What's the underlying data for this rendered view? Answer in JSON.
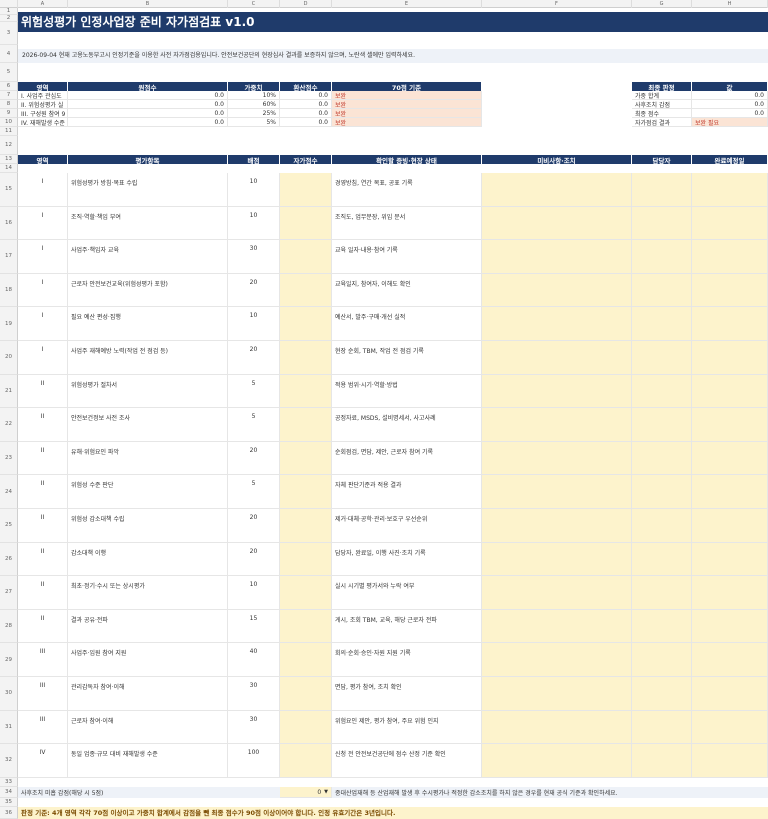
{
  "columns": [
    "A",
    "B",
    "C",
    "D",
    "E",
    "F",
    "G",
    "H"
  ],
  "title": "위험성평가 인정사업장 준비 자가점검표 v1.0",
  "note": "2026-09-04 현재 고용노동부고시 인정기준을 이용한 사전 자가점검용입니다. 안전보건공단의 현장심사 결과를 보증하지 않으며, 노란색 셀에만 입력하세요.",
  "summary": {
    "headers": [
      "영역",
      "원점수",
      "가중치",
      "환산점수",
      "70점 기준"
    ],
    "rows": [
      {
        "area": "I. 사업주 관심도",
        "raw": "0.0",
        "weight": "10%",
        "conv": "0.0",
        "std": "보완"
      },
      {
        "area": "II. 위험성평가 실",
        "raw": "0.0",
        "weight": "60%",
        "conv": "0.0",
        "std": "보완"
      },
      {
        "area": "III. 구성원 참여 9",
        "raw": "0.0",
        "weight": "25%",
        "conv": "0.0",
        "std": "보완"
      },
      {
        "area": "IV. 재해발생 수준",
        "raw": "0.0",
        "weight": "5%",
        "conv": "0.0",
        "std": "보완"
      }
    ]
  },
  "verdict": {
    "headers": [
      "최종 판정",
      "값"
    ],
    "rows": [
      {
        "label": "가중 합계",
        "value": "0.0"
      },
      {
        "label": "사후조치 감점",
        "value": "0.0"
      },
      {
        "label": "최종 점수",
        "value": "0.0"
      },
      {
        "label": "자가점검 결과",
        "value": "보완 필요"
      }
    ]
  },
  "table": {
    "headers": [
      "영역",
      "평가항목",
      "배점",
      "자가점수",
      "확인할 증빙·현장 상태",
      "미비사항·조치",
      "담당자",
      "완료예정일"
    ],
    "rows": [
      {
        "area": "I",
        "item": "위험성평가 방침·목표 수립",
        "score": "10",
        "evidence": "경영방침, 연간 목표, 공표 기록"
      },
      {
        "area": "I",
        "item": "조직·역할·책임 부여",
        "score": "10",
        "evidence": "조직도, 업무분장, 위임 문서"
      },
      {
        "area": "I",
        "item": "사업주·책임자 교육",
        "score": "30",
        "evidence": "교육 일자·내용·참여 기록"
      },
      {
        "area": "I",
        "item": "근로자 안전보건교육(위험성평가 포함)",
        "score": "20",
        "evidence": "교육일지, 참여자, 이해도 확인"
      },
      {
        "area": "I",
        "item": "필요 예산 편성·집행",
        "score": "10",
        "evidence": "예산서, 발주·구매·개선 실적"
      },
      {
        "area": "I",
        "item": "사업주 재해예방 노력(작업 전 점검 등)",
        "score": "20",
        "evidence": "현장 순회, TBM, 작업 전 점검 기록"
      },
      {
        "area": "II",
        "item": "위험성평가 절차서",
        "score": "5",
        "evidence": "적용 범위·시기·역할·방법"
      },
      {
        "area": "II",
        "item": "안전보건정보 사전 조사",
        "score": "5",
        "evidence": "공정자료, MSDS, 설비명세서, 사고사례"
      },
      {
        "area": "II",
        "item": "유해·위험요인 파악",
        "score": "20",
        "evidence": "순회점검, 면담, 제안, 근로자 참여 기록"
      },
      {
        "area": "II",
        "item": "위험성 수준 판단",
        "score": "5",
        "evidence": "자체 판단기준과 적용 결과"
      },
      {
        "area": "II",
        "item": "위험성 감소대책 수립",
        "score": "20",
        "evidence": "제거·대체·공학·관리·보호구 우선순위"
      },
      {
        "area": "II",
        "item": "감소대책 이행",
        "score": "20",
        "evidence": "담당자, 완료일, 이행 사진·조치 기록"
      },
      {
        "area": "II",
        "item": "최초·정기·수시 또는 상시평가",
        "score": "10",
        "evidence": "실시 시기별 평가서와 누락 여부"
      },
      {
        "area": "II",
        "item": "결과 공유·전파",
        "score": "15",
        "evidence": "게시, 조회 TBM, 교육, 해당 근로자 전파"
      },
      {
        "area": "III",
        "item": "사업주·임원 참여 지원",
        "score": "40",
        "evidence": "회의·순회·승인·자원 지원 기록"
      },
      {
        "area": "III",
        "item": "관리감독자 참여·이해",
        "score": "30",
        "evidence": "면담, 평가 참여, 조치 확인"
      },
      {
        "area": "III",
        "item": "근로자 참여·이해",
        "score": "30",
        "evidence": "위험요인 제안, 평가 참여, 주요 위험 인지"
      },
      {
        "area": "IV",
        "item": "동일 업종·규모 대비 재해발생 수준",
        "score": "100",
        "evidence": "신청 전 안전보건공단에 점수 산정 기준 확인"
      }
    ]
  },
  "row34": {
    "label": "사후조치 미흡 감점(해당 시 5점)",
    "value": "0",
    "note": "중대산업재해 등 산업재해 발생 후 수시평가나 적정한 감소조치를 하지 않은 경우를 현재 공식 기준과 확인하세요."
  },
  "footer": "판정 기준: 4개 영역 각각 70점 이상이고 가중치 합계에서 감점을 뺀 최종 점수가 90점 이상이어야 합니다. 인정 유효기간은 3년입니다.",
  "colors": {
    "header_navy": "#1f3b6b",
    "input_yellow": "#fdf3cc",
    "warn_pink": "#fbe4d5",
    "warn_red": "#c0392b"
  }
}
